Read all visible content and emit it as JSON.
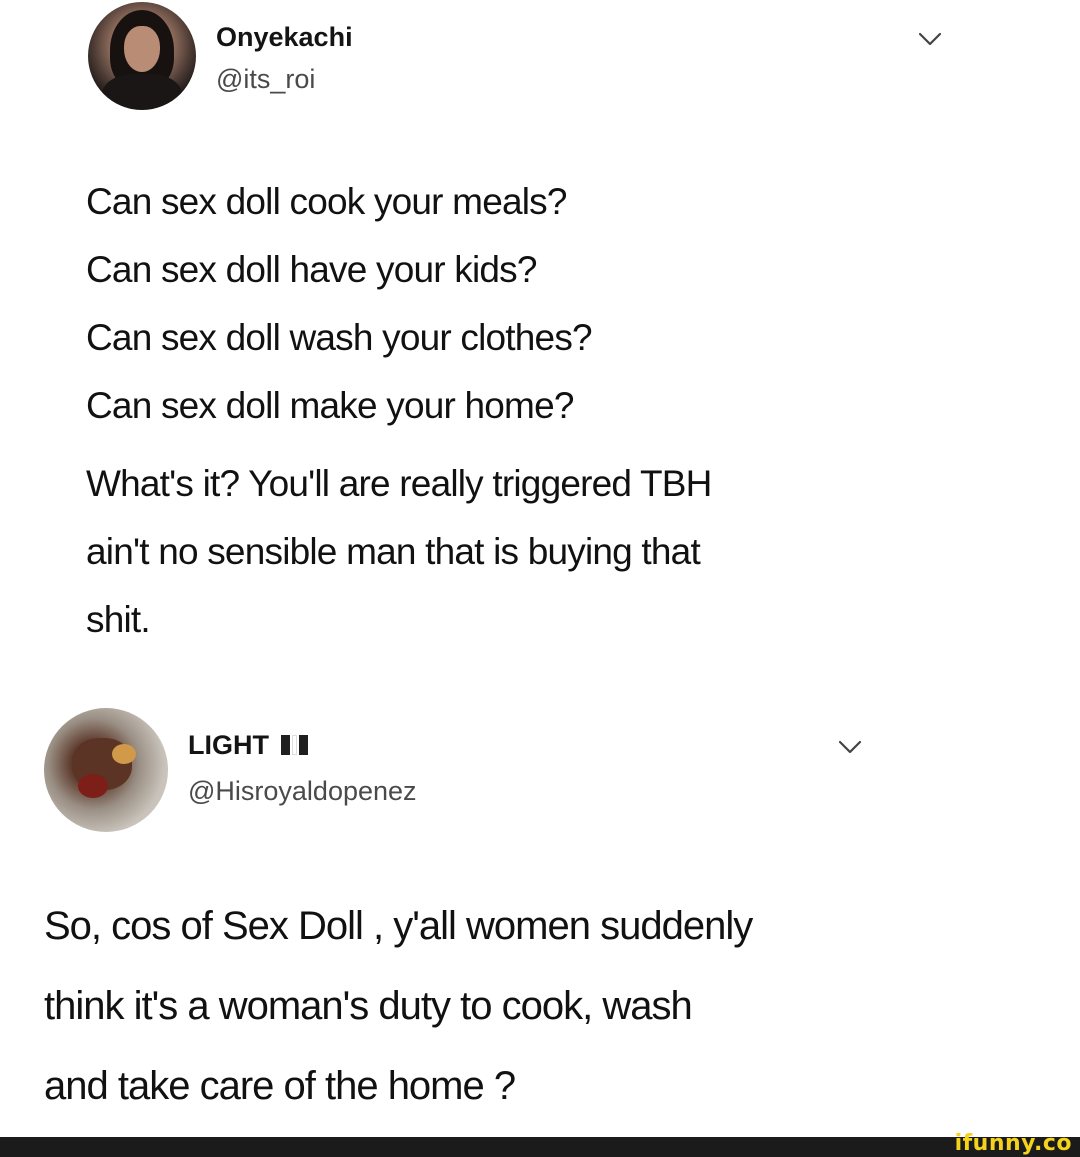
{
  "tweets": [
    {
      "author": {
        "display_name": "Onyekachi",
        "handle": "@its_roi"
      },
      "text_lines": [
        "Can sex doll cook your meals?",
        "Can sex doll have your kids?",
        "Can sex doll wash your clothes?",
        "Can sex doll make your home?"
      ],
      "text_lines_2": [
        "What's it? You'll are really triggered TBH",
        "ain't no sensible man that is buying that",
        "shit."
      ]
    },
    {
      "author": {
        "display_name": "LIGHT",
        "handle": "@Hisroyaldopenez"
      },
      "text_lines": [
        "So, cos of Sex Doll , y'all women suddenly",
        "think it's a woman's duty to cook, wash",
        "and take care of the home ?"
      ]
    }
  ],
  "icons": {
    "menu": "chevron-down-icon",
    "flag": "flag-icon"
  },
  "watermark": "ifunny.co",
  "colors": {
    "text": "#111111",
    "handle": "#4a4a4a",
    "watermark": "#f5d21c",
    "footer": "#1b1b1b"
  }
}
